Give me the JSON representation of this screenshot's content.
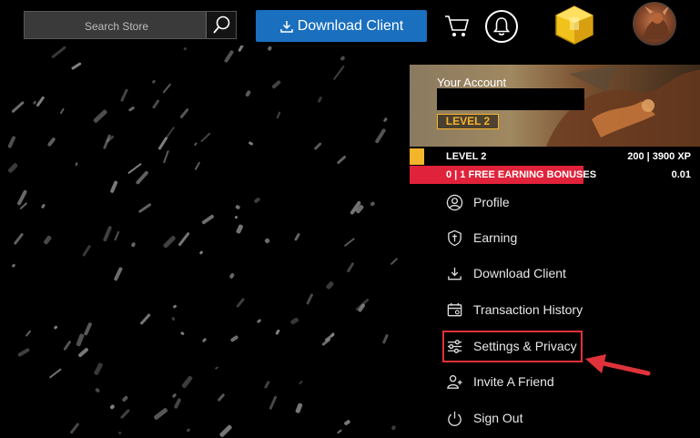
{
  "search": {
    "placeholder": "Search Store"
  },
  "header": {
    "download_label": "Download Client",
    "icons": [
      "search-icon",
      "download-icon",
      "cart-icon",
      "bell-icon",
      "gem-icon",
      "avatar"
    ]
  },
  "account": {
    "label": "Your Account",
    "level_badge": "LEVEL 2",
    "level": "LEVEL 2",
    "xp": "200 | 3900 XP",
    "xp_progress": 0.05,
    "bonus_label": "0 | 1 FREE EARNING BONUSES",
    "bonus_value": "0.01"
  },
  "menu": {
    "items": [
      {
        "label": "Profile",
        "icon": "user-icon"
      },
      {
        "label": "Earning",
        "icon": "shield-icon"
      },
      {
        "label": "Download Client",
        "icon": "download-icon"
      },
      {
        "label": "Transaction History",
        "icon": "history-icon"
      },
      {
        "label": "Settings & Privacy",
        "icon": "sliders-icon"
      },
      {
        "label": "Invite A Friend",
        "icon": "invite-icon"
      },
      {
        "label": "Sign Out",
        "icon": "power-icon"
      }
    ]
  },
  "colors": {
    "download_button": "#1a6fbe",
    "xp_bar": "#f2b52c",
    "bonus_bar": "#e0223a",
    "highlight": "#e0323a"
  }
}
